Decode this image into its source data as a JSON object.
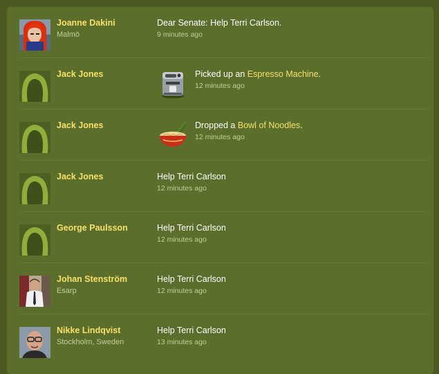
{
  "activity": [
    {
      "user": "Joanne Dakini",
      "location": "Malmö",
      "action_prefix": "Dear Senate: Help Terri Carlson.",
      "link": "",
      "action_suffix": "",
      "time": "9 minutes ago",
      "avatar_icon": "user-photo-red-hair",
      "item_icon": ""
    },
    {
      "user": "Jack Jones",
      "location": "",
      "action_prefix": "Picked up an ",
      "link": "Espresso Machine",
      "action_suffix": ".",
      "time": "12 minutes ago",
      "avatar_icon": "default-silhouette",
      "item_icon": "espresso-machine-icon"
    },
    {
      "user": "Jack Jones",
      "location": "",
      "action_prefix": "Dropped a ",
      "link": "Bowl of Noodles",
      "action_suffix": ".",
      "time": "12 minutes ago",
      "avatar_icon": "default-silhouette",
      "item_icon": "noodle-bowl-icon"
    },
    {
      "user": "Jack Jones",
      "location": "",
      "action_prefix": "Help Terri Carlson",
      "link": "",
      "action_suffix": "",
      "time": "12 minutes ago",
      "avatar_icon": "default-silhouette",
      "item_icon": ""
    },
    {
      "user": "George Paulsson",
      "location": "",
      "action_prefix": "Help Terri Carlson",
      "link": "",
      "action_suffix": "",
      "time": "12 minutes ago",
      "avatar_icon": "default-silhouette",
      "item_icon": ""
    },
    {
      "user": "Johan Stenström",
      "location": "Esarp",
      "action_prefix": "Help Terri Carlson",
      "link": "",
      "action_suffix": "",
      "time": "12 minutes ago",
      "avatar_icon": "user-photo-man-tie",
      "item_icon": ""
    },
    {
      "user": "Nikke Lindqvist",
      "location": "Stockholm, Sweden",
      "action_prefix": "Help Terri Carlson",
      "link": "",
      "action_suffix": "",
      "time": "13 minutes ago",
      "avatar_icon": "user-photo-man-glasses",
      "item_icon": ""
    }
  ],
  "colors": {
    "background": "#4a5a20",
    "panel": "#5b6e2b",
    "name": "#f6e06a",
    "meta": "#c5cf9c",
    "text": "#ffffff"
  }
}
